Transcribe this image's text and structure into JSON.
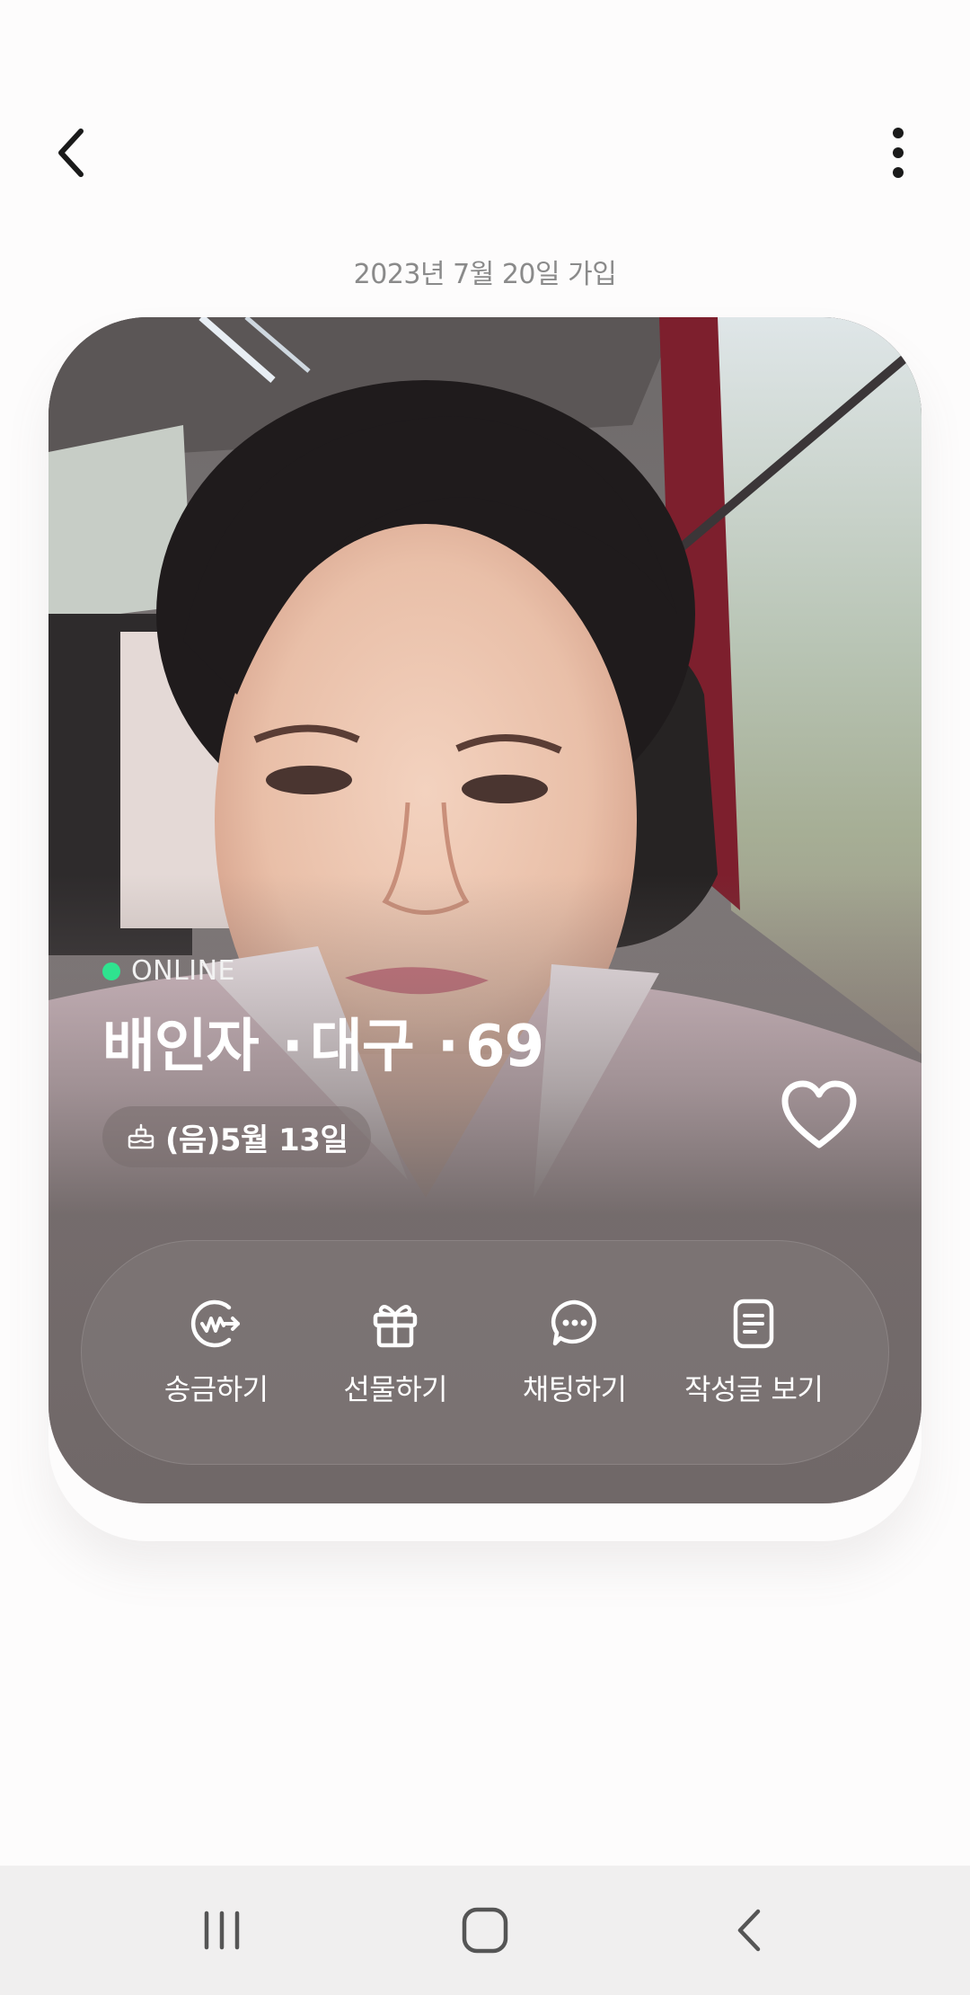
{
  "header": {
    "back_icon": "chevron-left-icon",
    "more_icon": "more-vertical-icon"
  },
  "join_date": "2023년 7월 20일 가입",
  "profile": {
    "status": "ONLINE",
    "status_color": "#2fe38f",
    "name": "배인자",
    "region": "대구",
    "age": "69",
    "birthday": "(음)5월 13일",
    "birthday_icon": "cake-icon",
    "liked": false
  },
  "actions": [
    {
      "label": "송금하기",
      "icon": "money-transfer-icon"
    },
    {
      "label": "선물하기",
      "icon": "gift-icon"
    },
    {
      "label": "채팅하기",
      "icon": "chat-icon"
    },
    {
      "label": "작성글 보기",
      "icon": "document-icon"
    }
  ],
  "nav": {
    "recents_icon": "recents-icon",
    "home_icon": "home-icon",
    "back_icon": "back-icon"
  }
}
